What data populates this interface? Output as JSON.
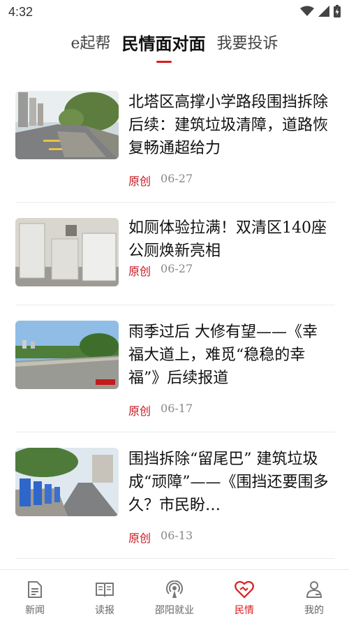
{
  "status_bar": {
    "time": "4:32"
  },
  "top_tabs": [
    {
      "label": "e起帮",
      "active": false
    },
    {
      "label": "民情面对面",
      "active": true
    },
    {
      "label": "我要投诉",
      "active": false
    }
  ],
  "news": [
    {
      "title": "北塔区高撑小学路段围挡拆除后续：建筑垃圾清障，道路恢复畅通超给力",
      "tag": "原创",
      "date": "06-27",
      "image": "street-road-photo"
    },
    {
      "title": "如厕体验拉满！双清区140座公厕焕新亮相",
      "tag": "原创",
      "date": "06-27",
      "image": "public-toilet-photo"
    },
    {
      "title": "雨季过后 大修有望——《幸福大道上，难觅“稳稳的幸福”》后续报道",
      "tag": "原创",
      "date": "06-17",
      "image": "avenue-road-photo"
    },
    {
      "title": "围挡拆除“留尾巴” 建筑垃圾成“顽障”——《围挡还要围多久？市民盼…",
      "tag": "原创",
      "date": "06-13",
      "image": "construction-barrier-photo"
    }
  ],
  "bottom_nav": [
    {
      "label": "新闻",
      "icon": "document-icon",
      "active": false
    },
    {
      "label": "读报",
      "icon": "open-book-icon",
      "active": false
    },
    {
      "label": "邵阳就业",
      "icon": "broadcast-icon",
      "active": false
    },
    {
      "label": "民情",
      "icon": "heart-handshake-icon",
      "active": true
    },
    {
      "label": "我的",
      "icon": "person-icon",
      "active": false
    }
  ],
  "colors": {
    "accent": "#d81e1e",
    "tag": "#c8161e",
    "date": "#888888"
  }
}
